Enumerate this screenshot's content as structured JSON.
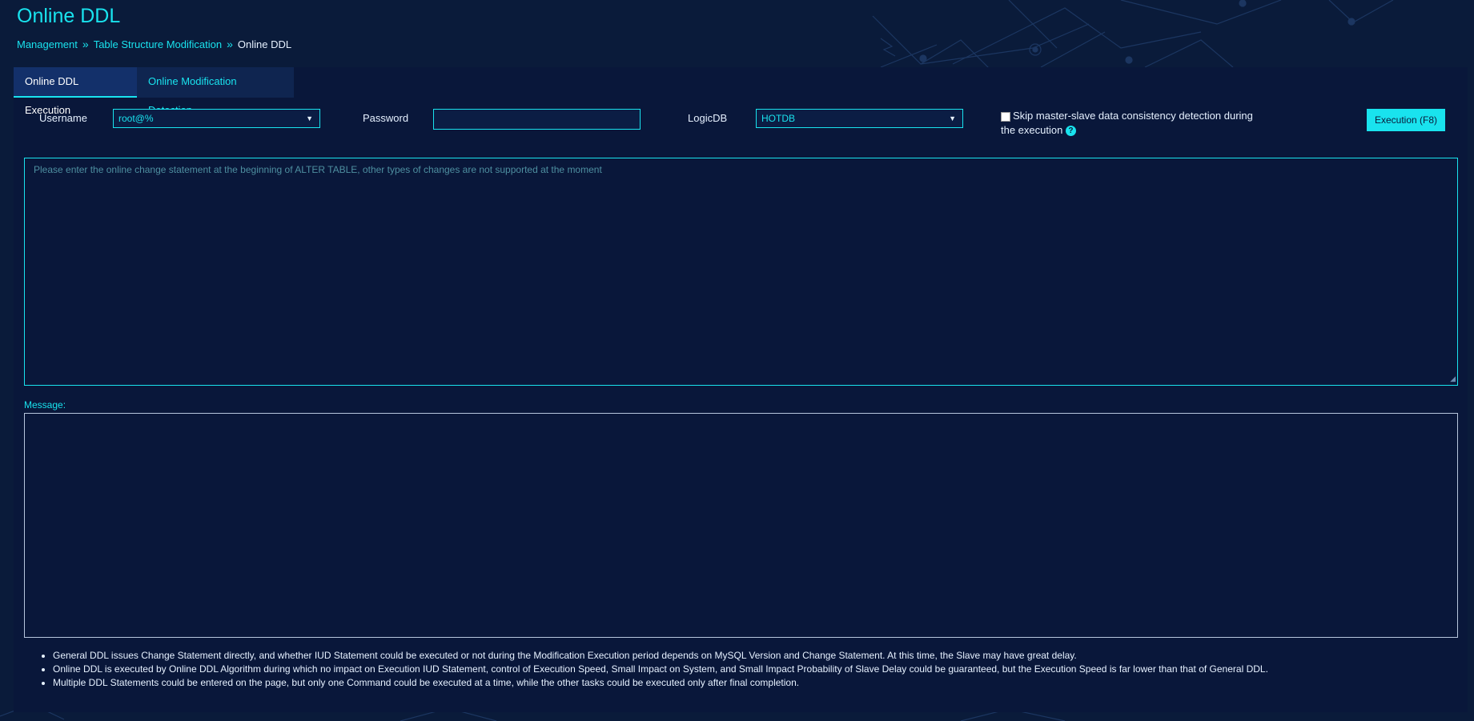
{
  "page": {
    "title": "Online DDL"
  },
  "breadcrumb": {
    "items": [
      "Management",
      "Table Structure Modification",
      "Online DDL"
    ]
  },
  "tabs": [
    {
      "label": "Online DDL Execution",
      "active": true
    },
    {
      "label": "Online Modification Detection",
      "active": false
    }
  ],
  "form": {
    "username_label": "Username",
    "username_value": "root@%",
    "password_label": "Password",
    "password_value": "",
    "logicdb_label": "LogicDB",
    "logicdb_value": "HOTDB",
    "skip_check_text": "Skip master-slave data consistency detection during the execution",
    "skip_check_checked": false,
    "execute_label": "Execution (F8)"
  },
  "editor": {
    "placeholder": "Please enter the online change statement at the beginning of ALTER TABLE, other types of changes are not supported at the moment"
  },
  "message": {
    "label": "Message:"
  },
  "notes": [
    "General DDL issues Change Statement directly, and whether IUD Statement could be executed or not during the Modification Execution period depends on MySQL Version and Change Statement. At this time, the Slave may have great delay.",
    "Online DDL is executed by Online DDL Algorithm during which no impact on Execution IUD Statement, control of Execution Speed, Small Impact on System, and Small Impact Probability of Slave Delay could be guaranteed, but the Execution Speed is far lower than that of General DDL.",
    "Multiple DDL Statements could be entered on the page, but only one Command could be executed at a time, while the other tasks could be executed only after final completion."
  ],
  "colors": {
    "accent": "#19e3ee",
    "background": "#0a1b3a",
    "panel": "#09173a"
  },
  "icons": {
    "dropdown": "caret-down-icon",
    "help": "question-circle-icon",
    "breadcrumb_separator": "double-chevron-right-icon"
  }
}
